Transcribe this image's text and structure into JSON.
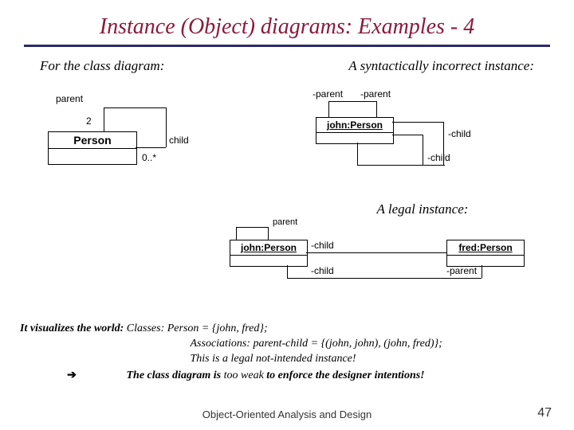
{
  "title": "Instance (Object) diagrams: Examples - 4",
  "subhead_left": "For the class diagram:",
  "subhead_right": "A syntactically incorrect instance:",
  "class_diagram": {
    "class_name": "Person",
    "role_parent": "parent",
    "mult_parent": "2",
    "role_child": "child",
    "mult_child": "0..*"
  },
  "incorrect_instance": {
    "object_label": "john:Person",
    "role_parent_a": "-parent",
    "role_parent_b": "-parent",
    "role_child_a": "-child",
    "role_child_b": "-child"
  },
  "legal_caption": "A legal instance:",
  "legal_instance": {
    "john_label": "john:Person",
    "fred_label": "fred:Person",
    "role_parent": "-parent",
    "role_child": "-child",
    "role_parent2": "parent",
    "role_child2": "-child"
  },
  "bottom": {
    "lead": "It visualizes the world:",
    "line1a": " Classes: Person = {john, fred};",
    "line2": "Associations: parent-child = {(john, john), (john, fred)};",
    "line3": "This is a legal not-intended instance!",
    "arrow": "➔",
    "line4a": "The class diagram is ",
    "line4b": "too weak ",
    "line4c": "to enforce the designer intentions!"
  },
  "footer": "Object-Oriented Analysis and Design",
  "page": "47"
}
